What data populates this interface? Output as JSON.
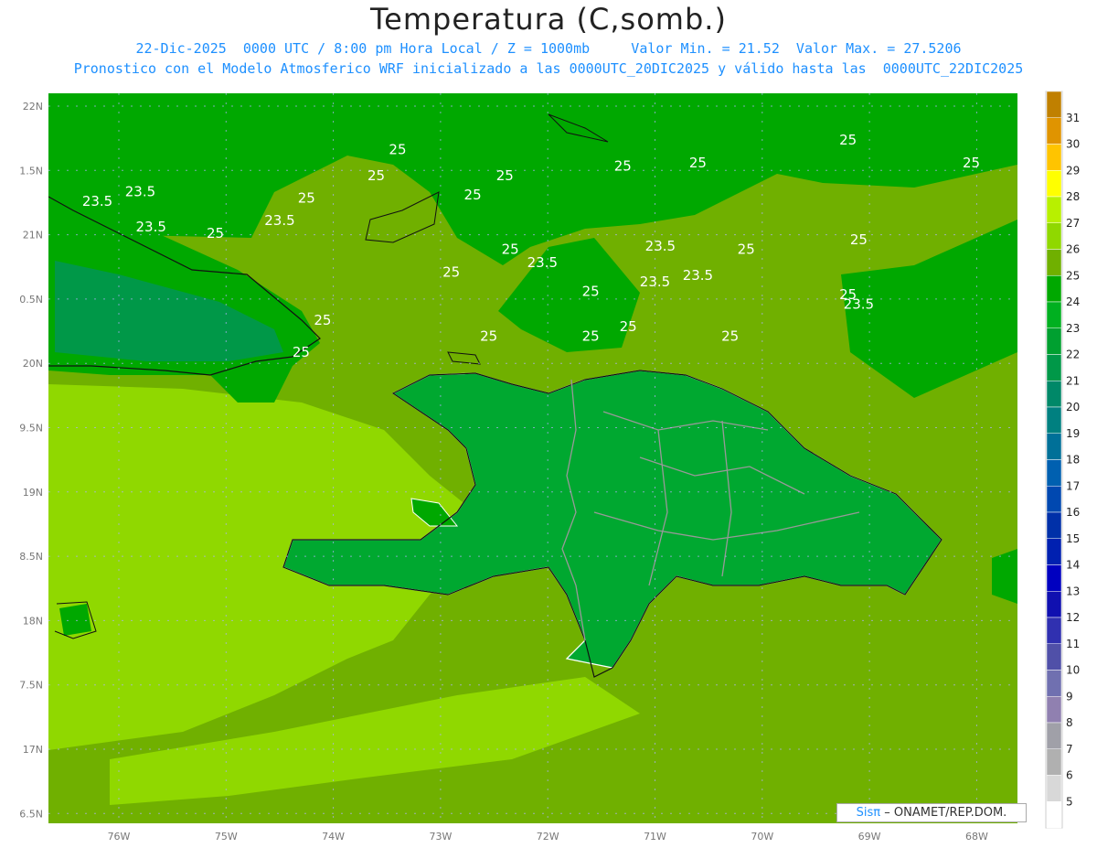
{
  "header": {
    "title": "Temperatura (C,somb.)",
    "line2": "22-Dic-2025  0000 UTC / 8:00 pm Hora Local / Z = 1000mb     Valor Min. = 21.52  Valor Max. = 27.5206",
    "line3": "Pronostico con el Modelo Atmosferico WRF inicializado a las 0000UTC_20DIC2025 y válido hasta las  0000UTC_22DIC2025"
  },
  "axes": {
    "lat_labels": [
      "22N",
      "1.5N",
      "21N",
      "0.5N",
      "20N",
      "9.5N",
      "19N",
      "8.5N",
      "18N",
      "7.5N",
      "17N",
      "6.5N"
    ],
    "lon_labels": [
      "76W",
      "75W",
      "74W",
      "73W",
      "72W",
      "71W",
      "70W",
      "69W",
      "68W"
    ]
  },
  "contour_labels": [
    {
      "text": "25",
      "lon": -73.4,
      "lat": 21.25
    },
    {
      "text": "25",
      "lon": -73.6,
      "lat": 20.85
    },
    {
      "text": "25",
      "lon": -72.7,
      "lat": 20.55
    },
    {
      "text": "25",
      "lon": -72.4,
      "lat": 20.85
    },
    {
      "text": "25",
      "lon": -71.3,
      "lat": 21.0
    },
    {
      "text": "25",
      "lon": -70.6,
      "lat": 21.05
    },
    {
      "text": "25",
      "lon": -69.2,
      "lat": 21.4
    },
    {
      "text": "25",
      "lon": -68.05,
      "lat": 21.05
    },
    {
      "text": "25",
      "lon": -74.25,
      "lat": 20.5
    },
    {
      "text": "25",
      "lon": -75.1,
      "lat": 19.95
    },
    {
      "text": "25",
      "lon": -69.1,
      "lat": 19.85
    },
    {
      "text": "25",
      "lon": -70.15,
      "lat": 19.7
    },
    {
      "text": "25",
      "lon": -72.35,
      "lat": 19.7
    },
    {
      "text": "25",
      "lon": -72.9,
      "lat": 19.35
    },
    {
      "text": "25",
      "lon": -71.6,
      "lat": 19.05
    },
    {
      "text": "25",
      "lon": -69.2,
      "lat": 19.0
    },
    {
      "text": "25",
      "lon": -74.1,
      "lat": 18.6
    },
    {
      "text": "25",
      "lon": -72.55,
      "lat": 18.35
    },
    {
      "text": "25",
      "lon": -71.25,
      "lat": 18.5
    },
    {
      "text": "25",
      "lon": -71.6,
      "lat": 18.35
    },
    {
      "text": "25",
      "lon": -70.3,
      "lat": 18.35
    },
    {
      "text": "25",
      "lon": -74.3,
      "lat": 18.1
    },
    {
      "text": "23.5",
      "lon": -75.8,
      "lat": 20.6
    },
    {
      "text": "23.5",
      "lon": -76.2,
      "lat": 20.45
    },
    {
      "text": "23.5",
      "lon": -75.7,
      "lat": 20.05
    },
    {
      "text": "23.5",
      "lon": -74.5,
      "lat": 20.15
    },
    {
      "text": "23.5",
      "lon": -72.05,
      "lat": 19.5
    },
    {
      "text": "23.5",
      "lon": -70.95,
      "lat": 19.75
    },
    {
      "text": "23.5",
      "lon": -70.6,
      "lat": 19.3
    },
    {
      "text": "23.5",
      "lon": -71.0,
      "lat": 19.2
    },
    {
      "text": "23.5",
      "lon": -69.1,
      "lat": 18.85
    }
  ],
  "colorbar": {
    "labels": [
      "31",
      "30",
      "29",
      "28",
      "27",
      "26",
      "25",
      "24",
      "23",
      "22",
      "21",
      "20",
      "19",
      "18",
      "17",
      "16",
      "15",
      "14",
      "13",
      "12",
      "11",
      "10",
      "9",
      "8",
      "7",
      "6",
      "5"
    ],
    "colors": [
      "#c08000",
      "#e09400",
      "#ffc400",
      "#ffff00",
      "#b8f000",
      "#90d800",
      "#70b000",
      "#00a800",
      "#00b020",
      "#00a030",
      "#009848",
      "#008868",
      "#008080",
      "#007098",
      "#0060b0",
      "#0048b0",
      "#0030a8",
      "#0020b0",
      "#0000c0",
      "#1010b0",
      "#3030b0",
      "#5050a8",
      "#7070b0",
      "#9080b0",
      "#a0a0a8",
      "#b0b0b0",
      "#d8d8d8",
      "#ffffff"
    ]
  },
  "credit": {
    "brand": "Sisπ",
    "text": "– ONAMET/REP.DOM."
  }
}
